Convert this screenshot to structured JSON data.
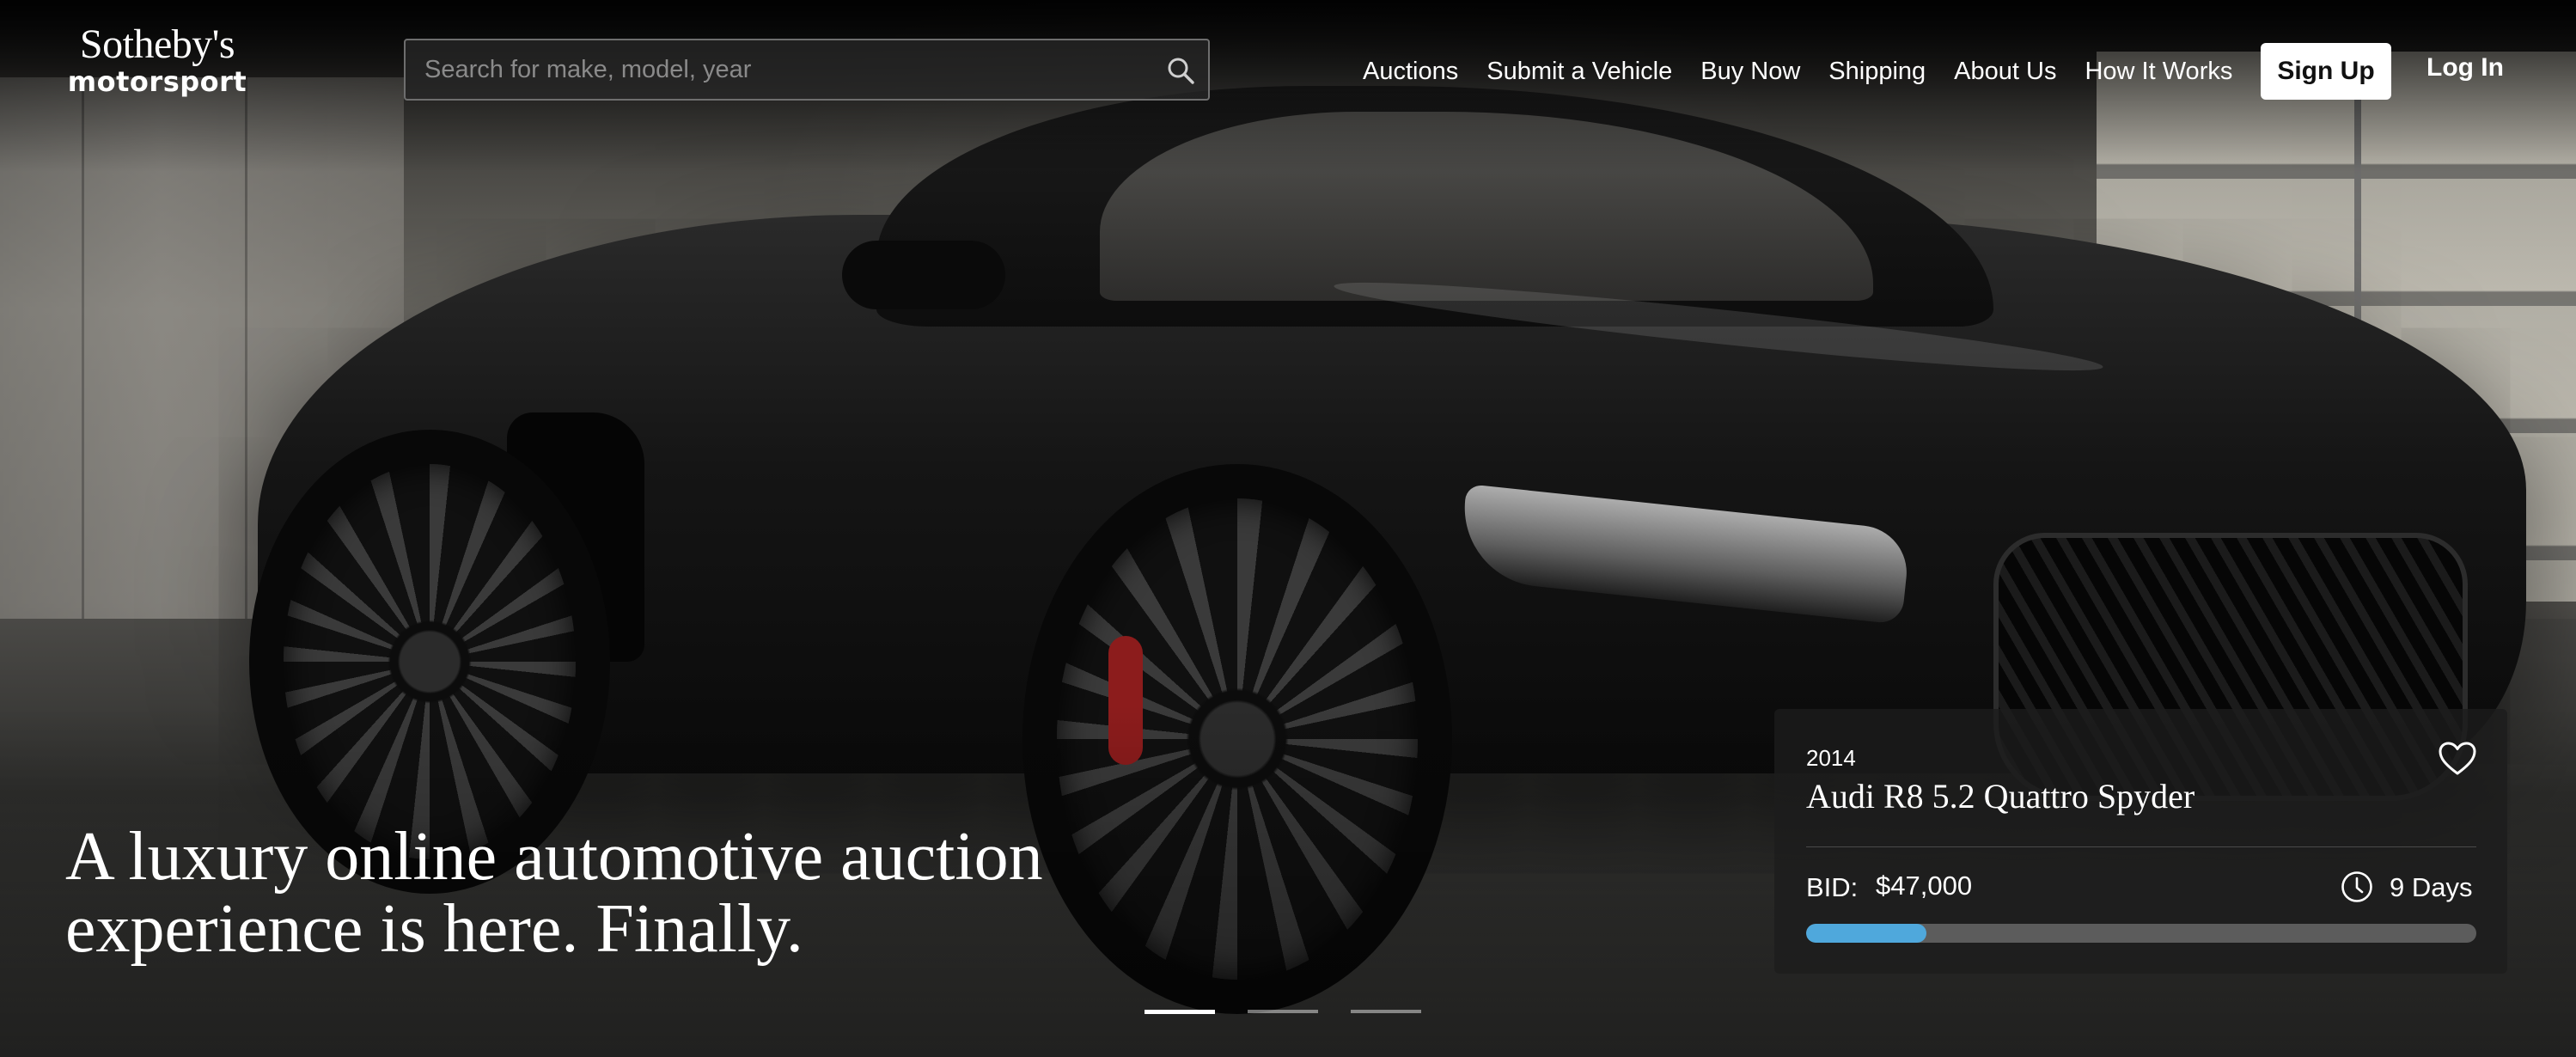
{
  "brand": {
    "logo_line1": "Sotheby's",
    "logo_line2": "motorsport"
  },
  "search": {
    "placeholder": "Search for make, model, year",
    "value": "",
    "icon": "search-icon"
  },
  "nav": {
    "items": [
      "Auctions",
      "Submit a Vehicle",
      "Buy Now",
      "Shipping",
      "About Us",
      "How It Works"
    ],
    "signup_label": "Sign Up",
    "login_label": "Log In"
  },
  "hero": {
    "headline": "A luxury online automotive auction experience is here. Finally.",
    "carousel_slides": 3,
    "active_slide": 1
  },
  "listing": {
    "year": "2014",
    "title": "Audi R8 5.2 Quattro Spyder",
    "bid_label": "BID:",
    "bid_value": "$47,000",
    "time_left": "9 Days",
    "progress_fraction": 0.18,
    "icons": [
      "heart-icon",
      "clock-icon"
    ]
  },
  "colors": {
    "progress_fill": "#4fa8dc",
    "progress_track": "#5c5c5c",
    "button_bg": "#ffffff"
  }
}
